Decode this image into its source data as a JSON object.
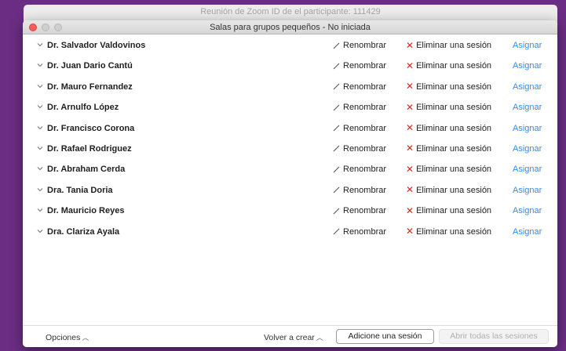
{
  "background_window": {
    "title": "Reunión de Zoom ID de el participante: 111429"
  },
  "window": {
    "title": "Salas para grupos pequeños - No iniciada"
  },
  "row_actions": {
    "rename_label": "Renombrar",
    "delete_label": "Eliminar una sesión",
    "assign_label": "Asignar"
  },
  "rooms": [
    {
      "name": "Dr. Salvador Valdovinos"
    },
    {
      "name": "Dr. Juan Dario Cantú"
    },
    {
      "name": "Dr. Mauro Fernandez"
    },
    {
      "name": "Dr. Arnulfo López"
    },
    {
      "name": "Dr. Francisco Corona"
    },
    {
      "name": "Dr. Rafael Rodriguez"
    },
    {
      "name": "Dr. Abraham Cerda"
    },
    {
      "name": "Dra. Tania Doria"
    },
    {
      "name": "Dr. Mauricio Reyes"
    },
    {
      "name": "Dra. Clariza Ayala"
    }
  ],
  "footer": {
    "options_label": "Opciones",
    "recreate_label": "Volver a crear",
    "add_session_label": "Adicione una sesión",
    "open_all_label": "Abrir todas las sesiones"
  },
  "colors": {
    "background": "#6b2d84",
    "link": "#2d8cff",
    "delete_x": "#e0261f",
    "close_light": "#fc5b57"
  }
}
